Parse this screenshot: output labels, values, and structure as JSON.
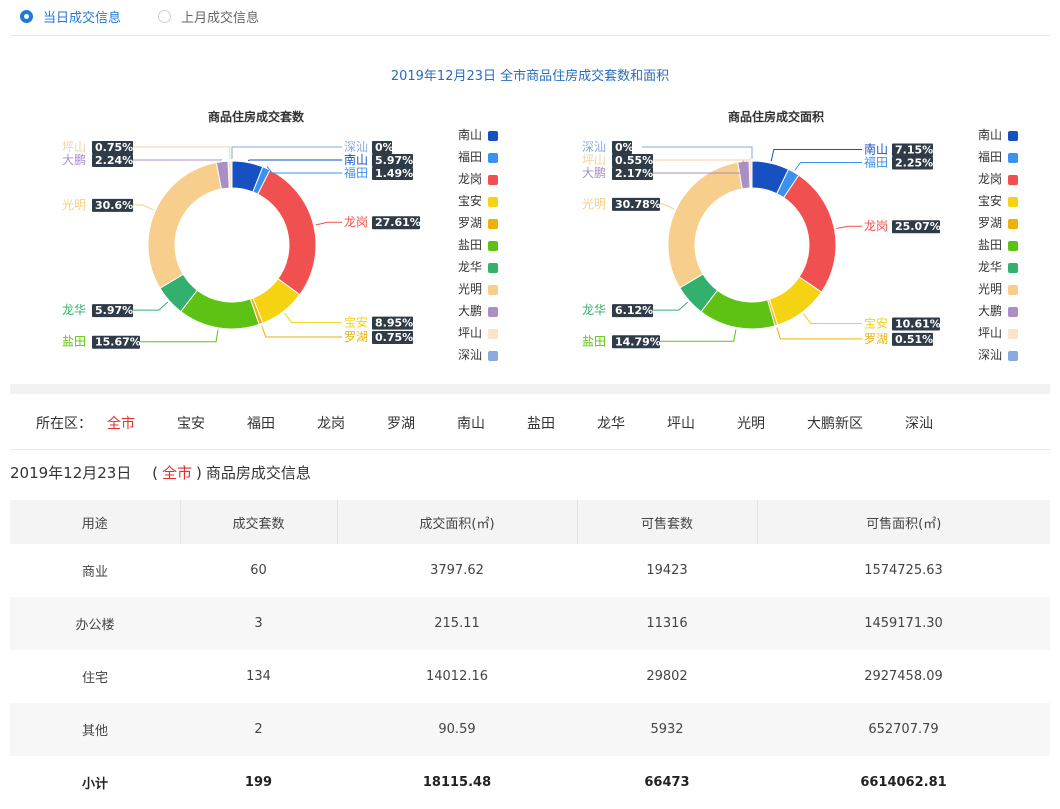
{
  "tabs": [
    {
      "label": "当日成交信息",
      "selected": true
    },
    {
      "label": "上月成交信息",
      "selected": false
    }
  ],
  "main_title": "2019年12月23日 全市商品住房成交套数和面积",
  "colors": {
    "accent": "#1f7ad9",
    "active": "#e52f2f",
    "label_bg": "#2f3b47"
  },
  "chart_data": [
    {
      "type": "pie",
      "title": "商品住房成交套数",
      "categories": [
        "南山",
        "福田",
        "龙岗",
        "宝安",
        "罗湖",
        "盐田",
        "龙华",
        "光明",
        "大鹏",
        "坪山",
        "深汕"
      ],
      "values": [
        5.97,
        1.49,
        27.61,
        8.95,
        0.75,
        15.67,
        5.97,
        30.6,
        2.24,
        0.75,
        0
      ],
      "labels": [
        "5.97%",
        "1.49%",
        "27.61%",
        "8.95%",
        "0.75%",
        "15.67%",
        "5.97%",
        "30.6%",
        "2.24%",
        "0.75%",
        "0%"
      ],
      "colors": [
        "#1650c1",
        "#3a91ef",
        "#f0504f",
        "#f5d312",
        "#ecb208",
        "#5ec214",
        "#34b06e",
        "#f8ce8c",
        "#a98fc3",
        "#fbe4c9",
        "#8aa9de"
      ],
      "legend": "right"
    },
    {
      "type": "pie",
      "title": "商品住房成交面积",
      "categories": [
        "南山",
        "福田",
        "龙岗",
        "宝安",
        "罗湖",
        "盐田",
        "龙华",
        "光明",
        "大鹏",
        "坪山",
        "深汕"
      ],
      "values": [
        7.15,
        2.25,
        25.07,
        10.61,
        0.51,
        14.79,
        6.12,
        30.78,
        2.17,
        0.55,
        0
      ],
      "labels": [
        "7.15%",
        "2.25%",
        "25.07%",
        "10.61%",
        "0.51%",
        "14.79%",
        "6.12%",
        "30.78%",
        "2.17%",
        "0.55%",
        "0%"
      ],
      "colors": [
        "#1650c1",
        "#3a91ef",
        "#f0504f",
        "#f5d312",
        "#ecb208",
        "#5ec214",
        "#34b06e",
        "#f8ce8c",
        "#a98fc3",
        "#fbe4c9",
        "#8aa9de"
      ],
      "legend": "right"
    }
  ],
  "districts": {
    "label": "所在区：",
    "items": [
      "全市",
      "宝安",
      "福田",
      "龙岗",
      "罗湖",
      "南山",
      "盐田",
      "龙华",
      "坪山",
      "光明",
      "大鹏新区",
      "深汕"
    ],
    "active": "全市"
  },
  "subtitle": {
    "date": "2019年12月23日",
    "open": "(",
    "region": "全市",
    "close": ")",
    "suffix": "商品房成交信息"
  },
  "table": {
    "headers": [
      "用途",
      "成交套数",
      "成交面积(㎡)",
      "可售套数",
      "可售面积(㎡)"
    ],
    "rows": [
      [
        "商业",
        "60",
        "3797.62",
        "19423",
        "1574725.63"
      ],
      [
        "办公楼",
        "3",
        "215.11",
        "11316",
        "1459171.30"
      ],
      [
        "住宅",
        "134",
        "14012.16",
        "29802",
        "2927458.09"
      ],
      [
        "其他",
        "2",
        "90.59",
        "5932",
        "652707.79"
      ]
    ],
    "total": [
      "小计",
      "199",
      "18115.48",
      "66473",
      "6614062.81"
    ]
  }
}
